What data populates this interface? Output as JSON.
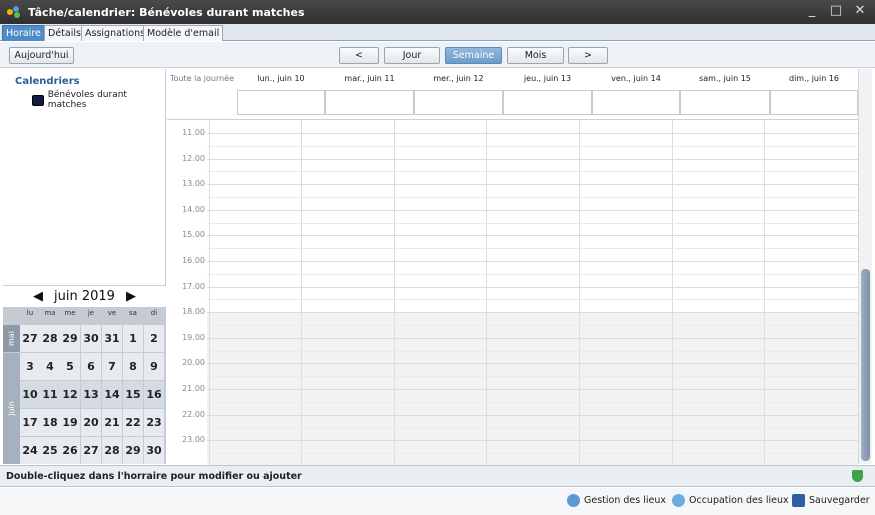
{
  "window": {
    "title": "Tâche/calendrier: Bénévoles durant matches",
    "controls": {
      "minimize": "_",
      "maximize": "□",
      "close": "✕"
    }
  },
  "tabs": [
    "Horaire",
    "Détails",
    "Assignations",
    "Modèle d'email"
  ],
  "toolbar": {
    "today": "Aujourd'hui",
    "prev": "<",
    "day": "Jour",
    "week": "Semaine",
    "month": "Mois",
    "next": ">"
  },
  "calendars": {
    "heading": "Calendriers",
    "items": [
      {
        "label": "Bénévoles durant matches",
        "color": "#0e1d40"
      }
    ]
  },
  "mini_calendar": {
    "month": "juin 2019",
    "prev_icon": "◀",
    "next_icon": "▶",
    "dow": [
      "lu",
      "ma",
      "me",
      "je",
      "ve",
      "sa",
      "di"
    ],
    "labels": {
      "mai": "mai",
      "juin": "juin"
    },
    "weeks": [
      [
        27,
        28,
        29,
        30,
        31,
        1,
        2
      ],
      [
        3,
        4,
        5,
        6,
        7,
        8,
        9
      ],
      [
        10,
        11,
        12,
        13,
        14,
        15,
        16
      ],
      [
        17,
        18,
        19,
        20,
        21,
        22,
        23
      ],
      [
        24,
        25,
        26,
        27,
        28,
        29,
        30
      ]
    ]
  },
  "schedule": {
    "allday_label": "Toute la journée",
    "days": [
      "lun., juin 10",
      "mar., juin 11",
      "mer., juin 12",
      "jeu., juin 13",
      "ven., juin 14",
      "sam., juin 15",
      "dim., juin 16"
    ],
    "hours": [
      "11.00",
      "12.00",
      "13.00",
      "14.00",
      "15.00",
      "16.00",
      "17.00",
      "18.00",
      "19.00",
      "20.00",
      "21.00",
      "22.00",
      "23.00"
    ]
  },
  "status": {
    "text": "Double-cliquez dans l'horraire pour modifier ou ajouter"
  },
  "footer": {
    "manage_venues": "Gestion des lieux",
    "venue_occupation": "Occupation des lieux",
    "save": "Sauvegarder"
  }
}
